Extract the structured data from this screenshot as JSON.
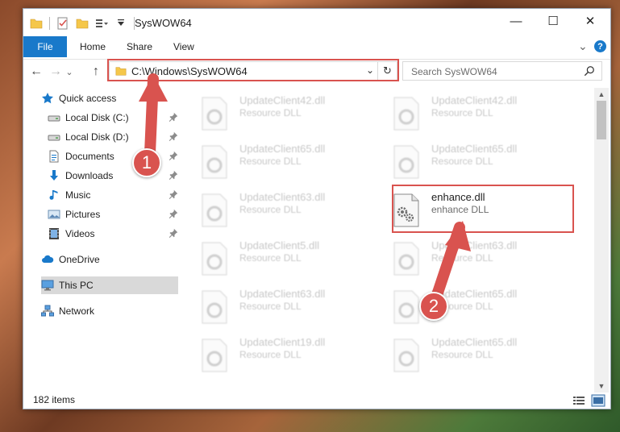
{
  "window": {
    "title": "SysWOW64",
    "controls": {
      "minimize": "—",
      "maximize": "☐",
      "close": "✕"
    }
  },
  "ribbon": {
    "tabs": [
      {
        "label": "File"
      },
      {
        "label": "Home"
      },
      {
        "label": "Share"
      },
      {
        "label": "View"
      }
    ],
    "expand_glyph": "⌄",
    "help_glyph": "?"
  },
  "navigation": {
    "back_glyph": "←",
    "forward_glyph": "→",
    "recent_glyph": "⌄",
    "up_glyph": "↑",
    "address_path": "C:\\Windows\\SysWOW64",
    "address_dropdown_glyph": "⌄",
    "refresh_glyph": "↻",
    "search_placeholder": "Search SysWOW64"
  },
  "sidebar": {
    "items": [
      {
        "label": "Quick access",
        "icon": "star-icon",
        "pinned": false
      },
      {
        "label": "Local Disk (C:)",
        "icon": "drive-icon",
        "pinned": true
      },
      {
        "label": "Local Disk (D:)",
        "icon": "drive-icon",
        "pinned": true
      },
      {
        "label": "Documents",
        "icon": "documents-icon",
        "pinned": true
      },
      {
        "label": "Downloads",
        "icon": "download-icon",
        "pinned": true
      },
      {
        "label": "Music",
        "icon": "music-icon",
        "pinned": true
      },
      {
        "label": "Pictures",
        "icon": "pictures-icon",
        "pinned": true
      },
      {
        "label": "Videos",
        "icon": "videos-icon",
        "pinned": true
      },
      {
        "label": "OneDrive",
        "icon": "cloud-icon",
        "pinned": false
      },
      {
        "label": "This PC",
        "icon": "computer-icon",
        "pinned": false,
        "selected": true
      },
      {
        "label": "Network",
        "icon": "network-icon",
        "pinned": false
      }
    ]
  },
  "files": [
    {
      "name": "UpdateClient42.dll",
      "type": "Resource DLL"
    },
    {
      "name": "UpdateClient42.dll",
      "type": "Resource DLL"
    },
    {
      "name": "UpdateClient65.dll",
      "type": "Resource DLL"
    },
    {
      "name": "UpdateClient65.dll",
      "type": "Resource DLL"
    },
    {
      "name": "UpdateClient63.dll",
      "type": "Resource DLL"
    },
    {
      "name": "enhance.dll",
      "type": "enhance DLL",
      "highlighted": true
    },
    {
      "name": "UpdateClient5.dll",
      "type": "Resource DLL"
    },
    {
      "name": "UpdateClient63.dll",
      "type": "Resource DLL"
    },
    {
      "name": "UpdateClient63.dll",
      "type": "Resource DLL"
    },
    {
      "name": "UpdateClient65.dll",
      "type": "Resource DLL"
    },
    {
      "name": "UpdateClient19.dll",
      "type": "Resource DLL"
    },
    {
      "name": "UpdateClient65.dll",
      "type": "Resource DLL"
    }
  ],
  "status": {
    "item_count": "182 items"
  },
  "annotations": {
    "callout_1": "1",
    "callout_2": "2",
    "color": "#d9534f"
  },
  "colors": {
    "file_tab": "#1979ca",
    "selection": "#d9d9d9",
    "folder": "#f5c74a"
  }
}
